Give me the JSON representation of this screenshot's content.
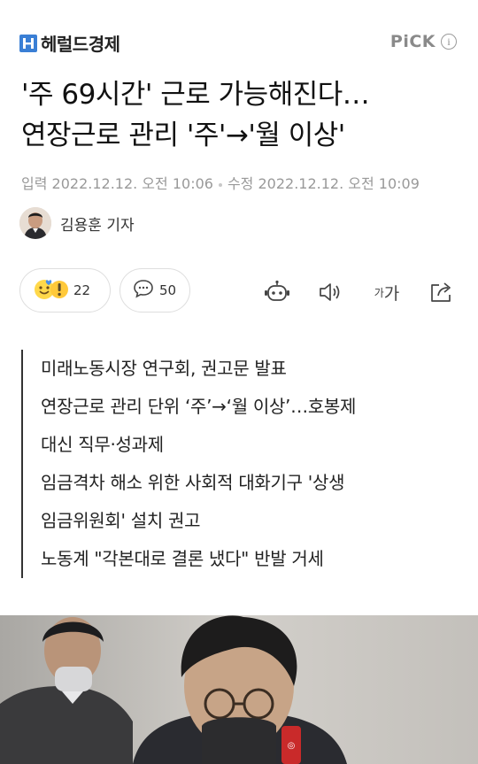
{
  "header": {
    "logo_text": "헤럴드경제",
    "pick_label": "PiCK",
    "info_glyph": "i"
  },
  "article": {
    "headline_lines": [
      "'주 69시간' 근로 가능해진다…",
      "연장근로 관리 '주'→'월 이상'"
    ],
    "published": "입력 2022.12.12. 오전 10:06",
    "modified": "수정 2022.12.12. 오전 10:09",
    "author": "김용훈 기자"
  },
  "actions": {
    "reaction_count": "22",
    "comment_count": "50",
    "icons": [
      "reaction-emoji-icon",
      "comment-icon",
      "robot-summary-icon",
      "audio-speaker-icon",
      "font-size-icon",
      "share-icon"
    ],
    "font_size_label": "가가"
  },
  "summary_lines": [
    "미래노동시장 연구회, 권고문 발표",
    "연장근로 관리 단위 ‘주’→‘월 이상’…호봉제",
    "대신 직무·성과제",
    "임금격차 해소 위한 사회적 대화기구 '상생",
    "임금위원회' 설치 권고",
    "노동계 \"각본대로 결론 냈다\" 반발 거세"
  ],
  "colors": {
    "logo_blue": "#3a7fd5",
    "text_primary": "#111111",
    "text_meta": "#999999",
    "border": "#dedede"
  }
}
